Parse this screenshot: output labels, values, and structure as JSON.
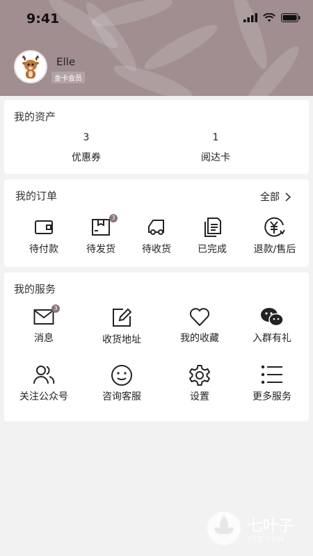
{
  "status_bar": {
    "time": "9:41"
  },
  "profile": {
    "username": "Elle",
    "member_level": "金卡会员"
  },
  "assets": {
    "title": "我的资产",
    "items": [
      {
        "value": "3",
        "label": "优惠券"
      },
      {
        "value": "1",
        "label": "阅达卡"
      }
    ]
  },
  "orders": {
    "title": "我的订单",
    "all_label": "全部",
    "items": [
      {
        "label": "待付款",
        "icon": "wallet-icon"
      },
      {
        "label": "待发货",
        "icon": "package-icon",
        "badge": "3"
      },
      {
        "label": "待收货",
        "icon": "truck-icon"
      },
      {
        "label": "已完成",
        "icon": "document-icon"
      },
      {
        "label": "退款/售后",
        "icon": "refund-icon"
      }
    ]
  },
  "services": {
    "title": "我的服务",
    "items": [
      {
        "label": "消息",
        "icon": "mail-icon",
        "badge": "3"
      },
      {
        "label": "收货地址",
        "icon": "edit-icon"
      },
      {
        "label": "我的收藏",
        "icon": "heart-icon"
      },
      {
        "label": "入群有礼",
        "icon": "wechat-icon"
      },
      {
        "label": "关注公众号",
        "icon": "users-icon"
      },
      {
        "label": "咨询客服",
        "icon": "smile-icon"
      },
      {
        "label": "设置",
        "icon": "gear-icon"
      },
      {
        "label": "更多服务",
        "icon": "list-icon"
      }
    ]
  },
  "watermark": {
    "text": "七叶子",
    "sub": "7YZ.COM"
  },
  "colors": {
    "header": "#a08e91",
    "badge": "#8a7478",
    "page_bg": "#f2f2f2"
  }
}
